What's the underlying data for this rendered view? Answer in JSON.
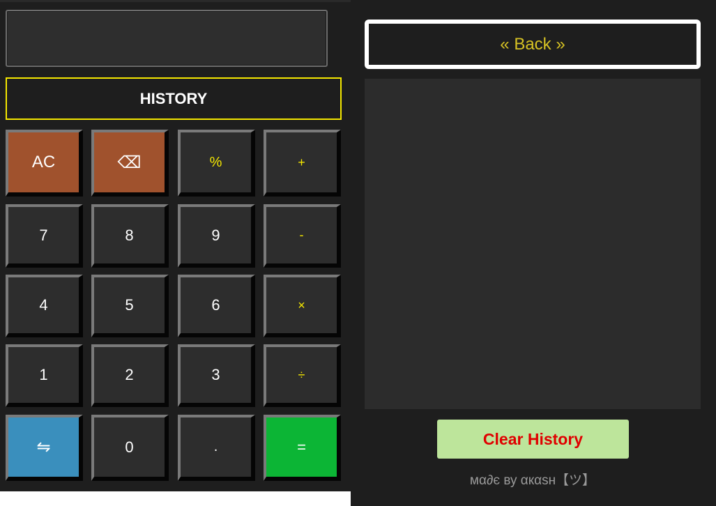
{
  "display": {
    "value": ""
  },
  "history_button": {
    "label": "HISTORY"
  },
  "keys": {
    "ac": "AC",
    "backspace": "⌫",
    "percent": "%",
    "plus": "+",
    "seven": "7",
    "eight": "8",
    "nine": "9",
    "minus": "-",
    "four": "4",
    "five": "5",
    "six": "6",
    "multiply": "×",
    "one": "1",
    "two": "2",
    "three": "3",
    "divide": "÷",
    "swap": "⇋",
    "zero": "0",
    "dot": ".",
    "equals": "="
  },
  "history_panel": {
    "back_label": "« Back »",
    "entries": [],
    "clear_label": "Clear History",
    "credit": "мα∂є ву αкαѕн【ツ】"
  },
  "colors": {
    "background": "#1e1e1e",
    "operator_text": "#f5e800",
    "ac_key": "#a0522d",
    "swap_key": "#3a8fbd",
    "equals_key": "#0cb535",
    "clear_button": "#bde59b",
    "clear_text": "#e00000"
  }
}
